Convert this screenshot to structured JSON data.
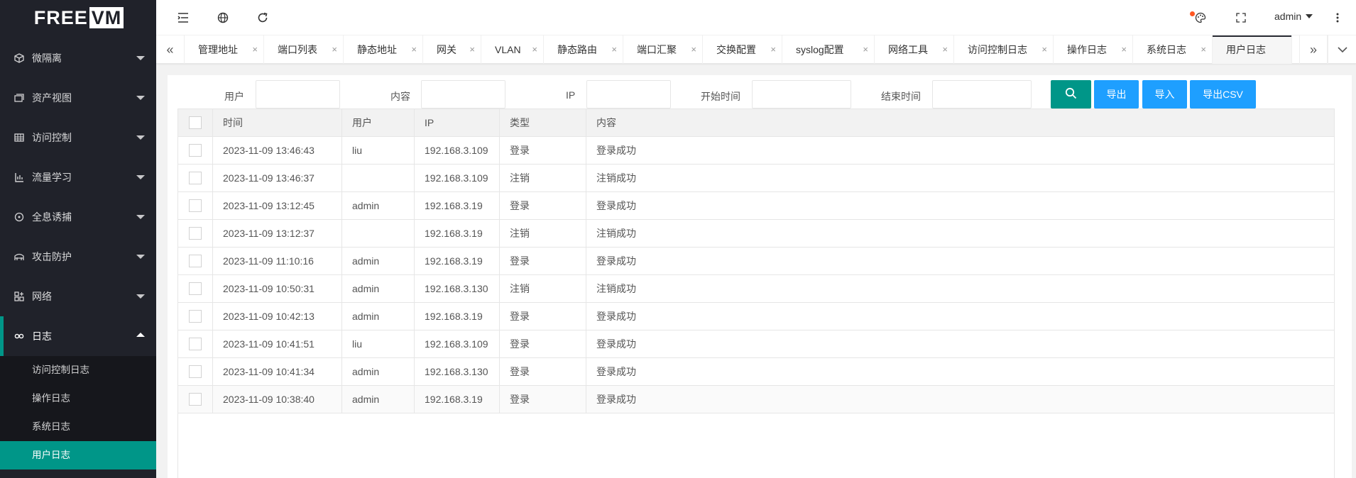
{
  "logo": {
    "part1": "FREE",
    "part2": "VM"
  },
  "sidebar": {
    "items": [
      {
        "label": "微隔离",
        "icon": "cube-icon"
      },
      {
        "label": "资产视图",
        "icon": "stack-icon"
      },
      {
        "label": "访问控制",
        "icon": "grid-icon"
      },
      {
        "label": "流量学习",
        "icon": "chart-icon"
      },
      {
        "label": "全息诱捕",
        "icon": "radar-icon"
      },
      {
        "label": "攻击防护",
        "icon": "shield-icon"
      },
      {
        "label": "网络",
        "icon": "network-icon"
      },
      {
        "label": "日志",
        "icon": "log-icon"
      }
    ],
    "sub_items": [
      "访问控制日志",
      "操作日志",
      "系统日志",
      "用户日志"
    ]
  },
  "header": {
    "user": "admin"
  },
  "tabs": [
    "管理地址",
    "端口列表",
    "静态地址",
    "网关",
    "VLAN",
    "静态路由",
    "端口汇聚",
    "交换配置",
    "syslog配置",
    "网络工具",
    "访问控制日志",
    "操作日志",
    "系统日志",
    "用户日志"
  ],
  "filters": {
    "user_label": "用户",
    "content_label": "内容",
    "ip_label": "IP",
    "start_label": "开始时间",
    "end_label": "结束时间"
  },
  "buttons": {
    "export": "导出",
    "import": "导入",
    "export_csv": "导出CSV"
  },
  "table": {
    "headers": [
      "时间",
      "用户",
      "IP",
      "类型",
      "内容"
    ],
    "rows": [
      [
        "2023-11-09 13:46:43",
        "liu",
        "192.168.3.109",
        "登录",
        "登录成功"
      ],
      [
        "2023-11-09 13:46:37",
        "",
        "192.168.3.109",
        "注销",
        "注销成功"
      ],
      [
        "2023-11-09 13:12:45",
        "admin",
        "192.168.3.19",
        "登录",
        "登录成功"
      ],
      [
        "2023-11-09 13:12:37",
        "",
        "192.168.3.19",
        "注销",
        "注销成功"
      ],
      [
        "2023-11-09 11:10:16",
        "admin",
        "192.168.3.19",
        "登录",
        "登录成功"
      ],
      [
        "2023-11-09 10:50:31",
        "admin",
        "192.168.3.130",
        "注销",
        "注销成功"
      ],
      [
        "2023-11-09 10:42:13",
        "admin",
        "192.168.3.19",
        "登录",
        "登录成功"
      ],
      [
        "2023-11-09 10:41:51",
        "liu",
        "192.168.3.109",
        "登录",
        "登录成功"
      ],
      [
        "2023-11-09 10:41:34",
        "admin",
        "192.168.3.130",
        "登录",
        "登录成功"
      ],
      [
        "2023-11-09 10:38:40",
        "admin",
        "192.168.3.19",
        "登录",
        "登录成功"
      ]
    ]
  },
  "colors": {
    "sidebar_bg": "#20222a",
    "accent": "#009688",
    "button_blue": "#1e9fff"
  }
}
